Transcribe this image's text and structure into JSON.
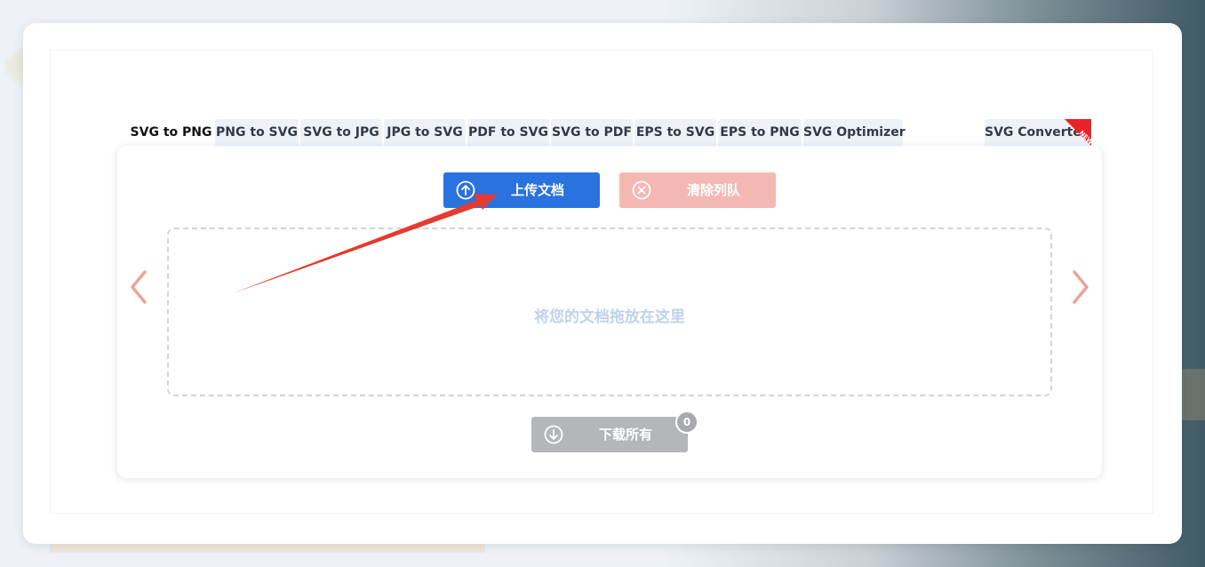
{
  "tabs": [
    {
      "label": "SVG to PNG",
      "active": true
    },
    {
      "label": "PNG to SVG"
    },
    {
      "label": "SVG to JPG"
    },
    {
      "label": "JPG to SVG"
    },
    {
      "label": "PDF to SVG"
    },
    {
      "label": "SVG to PDF"
    },
    {
      "label": "EPS to SVG"
    },
    {
      "label": "EPS to PNG"
    },
    {
      "label": "SVG Optimizer"
    },
    {
      "label": "SVG Converter",
      "ribbon": "NEW"
    }
  ],
  "actions": {
    "upload_label": "上传文档",
    "clear_label": "清除列队",
    "download_label": "下载所有",
    "download_count": "0"
  },
  "dropzone": {
    "text": "将您的文档拖放在这里"
  },
  "icons": {
    "upload": "arrow-up-circle-icon",
    "clear": "close-circle-icon",
    "download": "arrow-down-circle-icon",
    "prev": "chevron-left-icon",
    "next": "chevron-right-icon"
  },
  "colors": {
    "upload_button": "#2a72e0",
    "clear_button": "#f4b8b2",
    "download_button": "#b4b6b9",
    "ribbon": "#e8212b",
    "nav_arrow": "#e9a698",
    "annotation_arrow": "#e63a2e",
    "dropzone_text": "#bfd2ea"
  }
}
